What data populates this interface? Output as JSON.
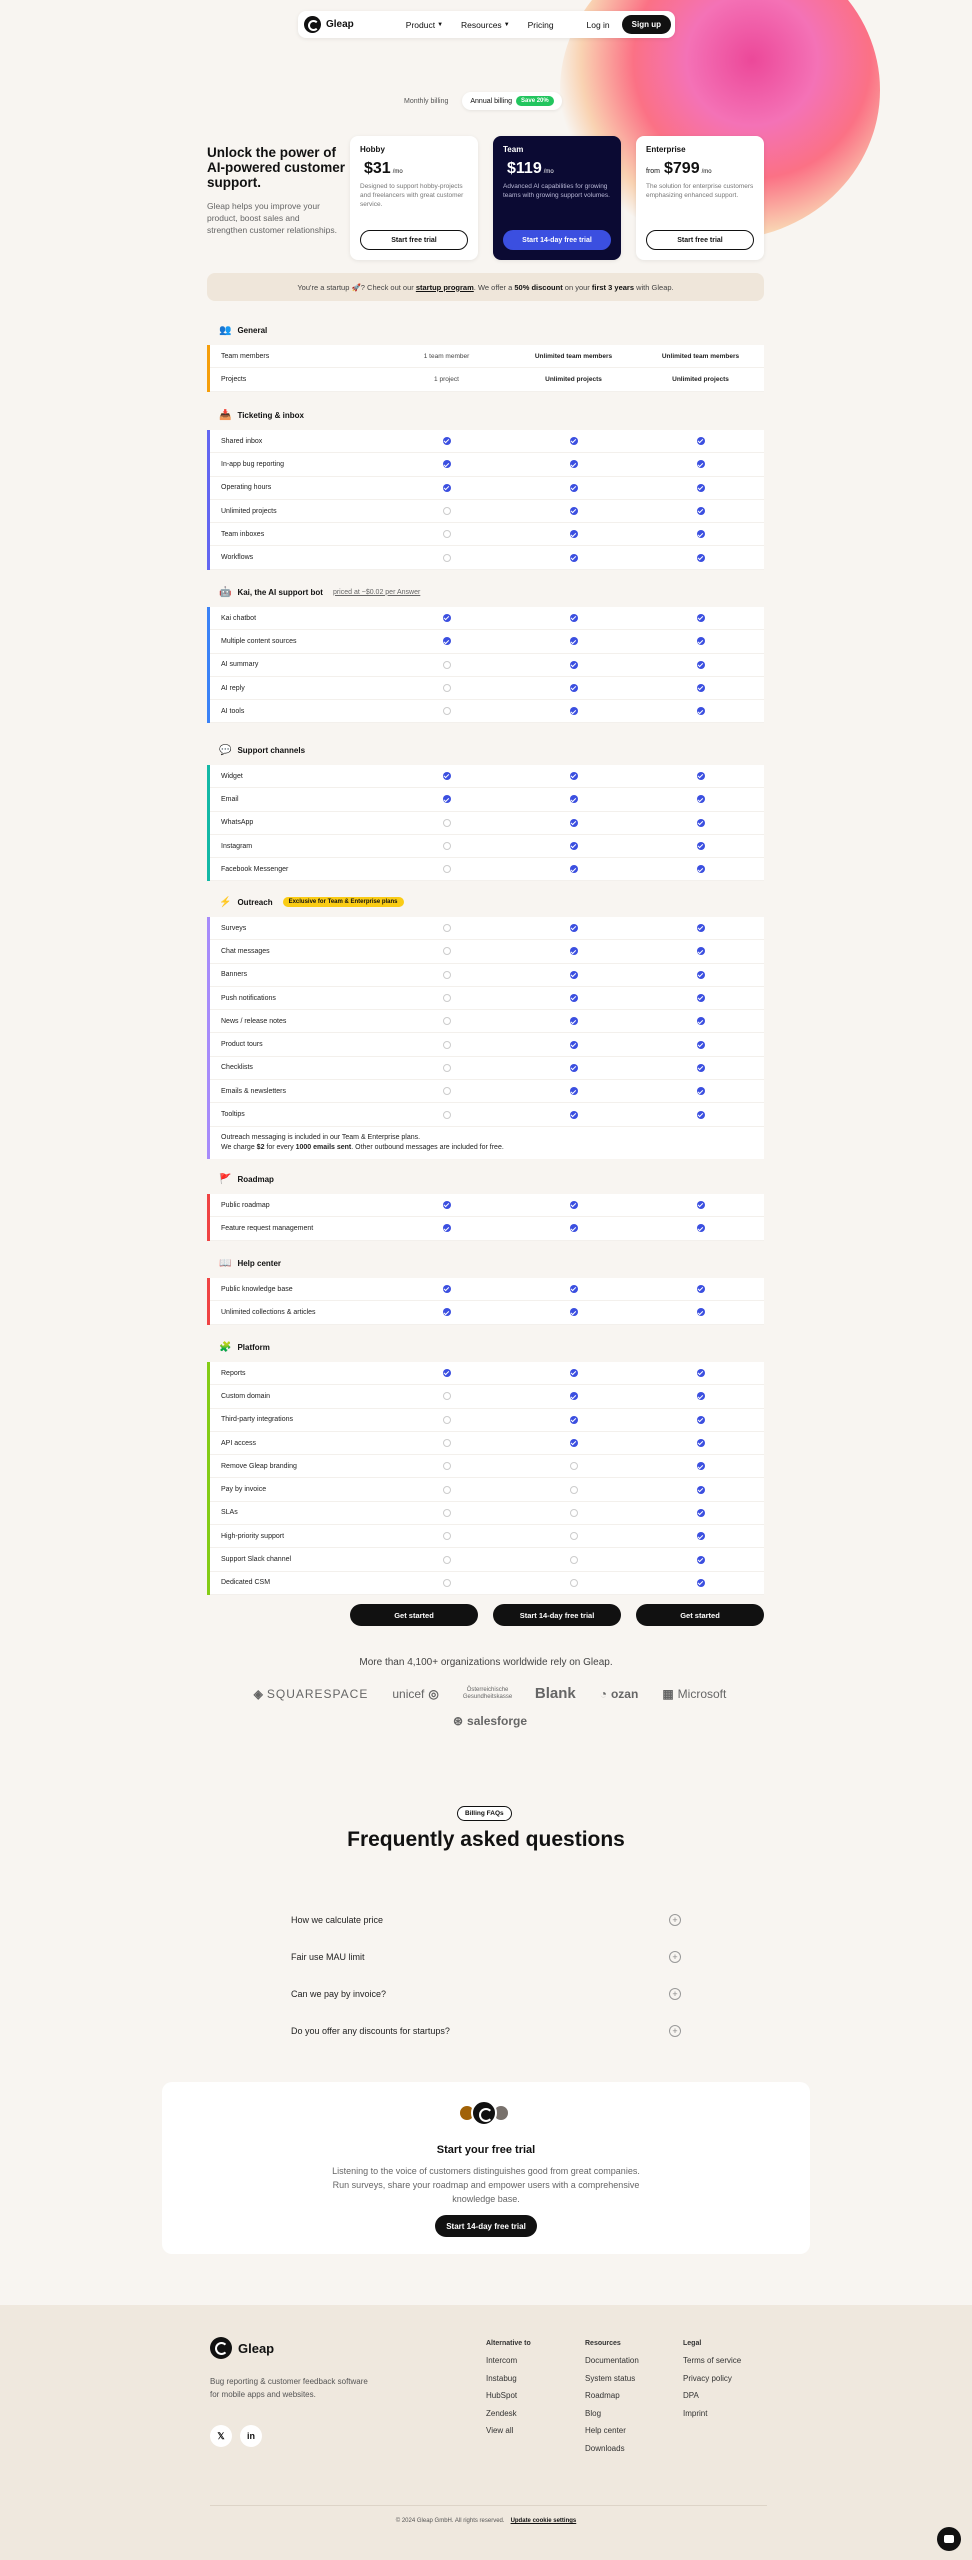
{
  "nav": {
    "brand": "Gleap",
    "links": [
      "Product",
      "Resources",
      "Pricing"
    ],
    "login": "Log in",
    "signup": "Sign up"
  },
  "billing": {
    "monthly": "Monthly billing",
    "annual": "Annual billing",
    "save": "Save 20%"
  },
  "hero": {
    "title": "Unlock the power of AI-powered customer support.",
    "subtitle": "Gleap helps you improve your product, boost sales and strengthen customer relationships."
  },
  "plans": [
    {
      "name": "Hobby",
      "prefix": "",
      "price": "$31",
      "unit": "/mo",
      "desc": "Designed to support hobby-projects and freelancers with great customer service.",
      "cta": "Start free trial"
    },
    {
      "name": "Team",
      "prefix": "",
      "price": "$119",
      "unit": "/mo",
      "desc": "Advanced AI capabilities for growing teams with growing support volumes.",
      "cta": "Start 14-day free trial"
    },
    {
      "name": "Enterprise",
      "prefix": "from",
      "price": "$799",
      "unit": "/mo",
      "desc": "The solution for enterprise customers emphasizing enhanced support.",
      "cta": "Start free trial"
    }
  ],
  "startup": {
    "p1": "You're a startup 🚀? Check out our ",
    "link": "startup program",
    "p2": ". We offer a ",
    "disc": "50% discount",
    "p3": " on your ",
    "years": "first 3 years",
    "p4": " with Gleap."
  },
  "sections": [
    {
      "title": "General",
      "icon": "👥",
      "color": "#f59e0b",
      "rows": [
        {
          "label": "Team members",
          "cells": [
            "1 team member",
            "Unlimited team members",
            "Unlimited team members"
          ]
        },
        {
          "label": "Projects",
          "cells": [
            "1 project",
            "Unlimited projects",
            "Unlimited projects"
          ]
        }
      ]
    },
    {
      "title": "Ticketing & inbox",
      "icon": "📥",
      "color": "#6366f1",
      "rows": [
        {
          "label": "Shared inbox",
          "cells": [
            true,
            true,
            true
          ]
        },
        {
          "label": "In-app bug reporting",
          "cells": [
            true,
            true,
            true
          ]
        },
        {
          "label": "Operating hours",
          "cells": [
            true,
            true,
            true
          ]
        },
        {
          "label": "Unlimited projects",
          "cells": [
            false,
            true,
            true
          ]
        },
        {
          "label": "Team inboxes",
          "cells": [
            false,
            true,
            true
          ]
        },
        {
          "label": "Workflows",
          "cells": [
            false,
            true,
            true
          ]
        }
      ]
    },
    {
      "title": "Kai, the AI support bot",
      "extra": "priced at ~$0.02 per Answer",
      "icon": "🤖",
      "color": "#3b82f6",
      "rows": [
        {
          "label": "Kai chatbot",
          "cells": [
            true,
            true,
            true
          ]
        },
        {
          "label": "Multiple content sources",
          "cells": [
            true,
            true,
            true
          ]
        },
        {
          "label": "AI summary",
          "cells": [
            false,
            true,
            true
          ]
        },
        {
          "label": "AI reply",
          "cells": [
            false,
            true,
            true
          ]
        },
        {
          "label": "AI tools",
          "cells": [
            false,
            true,
            true
          ]
        }
      ]
    },
    {
      "title": "Support channels",
      "icon": "💬",
      "color": "#14b8a6",
      "rows": [
        {
          "label": "Widget",
          "cells": [
            true,
            true,
            true
          ]
        },
        {
          "label": "Email",
          "cells": [
            true,
            true,
            true
          ]
        },
        {
          "label": "WhatsApp",
          "cells": [
            false,
            true,
            true
          ]
        },
        {
          "label": "Instagram",
          "cells": [
            false,
            true,
            true
          ]
        },
        {
          "label": "Facebook Messenger",
          "cells": [
            false,
            true,
            true
          ]
        }
      ]
    },
    {
      "title": "Outreach",
      "badge": "Exclusive for Team & Enterprise plans",
      "icon": "⚡",
      "color": "#a78bfa",
      "rows": [
        {
          "label": "Surveys",
          "cells": [
            false,
            true,
            true
          ]
        },
        {
          "label": "Chat messages",
          "cells": [
            false,
            true,
            true
          ]
        },
        {
          "label": "Banners",
          "cells": [
            false,
            true,
            true
          ]
        },
        {
          "label": "Push notifications",
          "cells": [
            false,
            true,
            true
          ]
        },
        {
          "label": "News / release notes",
          "cells": [
            false,
            true,
            true
          ]
        },
        {
          "label": "Product tours",
          "cells": [
            false,
            true,
            true
          ]
        },
        {
          "label": "Checklists",
          "cells": [
            false,
            true,
            true
          ]
        },
        {
          "label": "Emails & newsletters",
          "cells": [
            false,
            true,
            true
          ]
        },
        {
          "label": "Tooltips",
          "cells": [
            false,
            true,
            true
          ]
        }
      ],
      "note1": "Outreach messaging is included in our Team & Enterprise plans.",
      "note2a": "We charge ",
      "note2b": "$2",
      "note2c": " for every ",
      "note2d": "1000 emails sent",
      "note2e": ". Other outbound messages are included for free."
    },
    {
      "title": "Roadmap",
      "icon": "🚩",
      "color": "#ef4444",
      "rows": [
        {
          "label": "Public roadmap",
          "cells": [
            true,
            true,
            true
          ]
        },
        {
          "label": "Feature request management",
          "cells": [
            true,
            true,
            true
          ]
        }
      ]
    },
    {
      "title": "Help center",
      "icon": "📖",
      "color": "#ef4444",
      "rows": [
        {
          "label": "Public knowledge base",
          "cells": [
            true,
            true,
            true
          ]
        },
        {
          "label": "Unlimited collections & articles",
          "cells": [
            true,
            true,
            true
          ]
        }
      ]
    },
    {
      "title": "Platform",
      "icon": "🧩",
      "color": "#84cc16",
      "rows": [
        {
          "label": "Reports",
          "cells": [
            true,
            true,
            true
          ]
        },
        {
          "label": "Custom domain",
          "cells": [
            false,
            true,
            true
          ]
        },
        {
          "label": "Third-party integrations",
          "cells": [
            false,
            true,
            true
          ]
        },
        {
          "label": "API access",
          "cells": [
            false,
            true,
            true
          ]
        },
        {
          "label": "Remove Gleap branding",
          "cells": [
            false,
            false,
            true
          ]
        },
        {
          "label": "Pay by invoice",
          "cells": [
            false,
            false,
            true
          ]
        },
        {
          "label": "SLAs",
          "cells": [
            false,
            false,
            true
          ]
        },
        {
          "label": "High-priority support",
          "cells": [
            false,
            false,
            true
          ]
        },
        {
          "label": "Support Slack channel",
          "cells": [
            false,
            false,
            true
          ]
        },
        {
          "label": "Dedicated CSM",
          "cells": [
            false,
            false,
            true
          ]
        }
      ]
    }
  ],
  "bottom_buttons": [
    "Get started",
    "Start 14-day free trial",
    "Get started"
  ],
  "trusted": "More than 4,100+ organizations worldwide rely on Gleap.",
  "logos": [
    "SQUARESPACE",
    "unicef",
    "Österreichische Gesundheitskasse",
    "Blank",
    "ozan",
    "Microsoft",
    "salesforge"
  ],
  "faq": {
    "pill": "Billing FAQs",
    "title": "Frequently asked questions",
    "items": [
      "How we calculate price",
      "Fair use MAU limit",
      "Can we pay by invoice?",
      "Do you offer any discounts for startups?"
    ]
  },
  "cta": {
    "title": "Start your free trial",
    "sub": "Listening to the voice of customers distinguishes good from great companies. Run surveys, share your roadmap and empower users with a comprehensive knowledge base.",
    "btn": "Start 14-day free trial"
  },
  "footer": {
    "brand": "Gleap",
    "tagline": "Bug reporting & customer feedback software for mobile apps and websites.",
    "cols": [
      {
        "title": "Alternative to",
        "links": [
          "Intercom",
          "Instabug",
          "HubSpot",
          "Zendesk",
          "View all"
        ]
      },
      {
        "title": "Resources",
        "links": [
          "Documentation",
          "System status",
          "Roadmap",
          "Blog",
          "Help center",
          "Downloads"
        ]
      },
      {
        "title": "Legal",
        "links": [
          "Terms of service",
          "Privacy policy",
          "DPA",
          "Imprint"
        ]
      }
    ],
    "copyright": "© 2024 Gleap GmbH. All rights reserved.",
    "cookie": "Update cookie settings"
  }
}
